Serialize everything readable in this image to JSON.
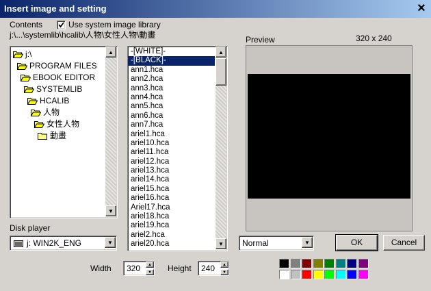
{
  "window": {
    "title": "Insert image and setting",
    "close_glyph": "✕"
  },
  "header": {
    "contents_label": "Contents",
    "use_library_label": "Use system image library",
    "use_library_checked": true,
    "path": "j:\\...\\systemlib\\hcalib\\人物\\女性人物\\動畫"
  },
  "tree": {
    "items": [
      {
        "label": "j:\\",
        "open": true
      },
      {
        "label": "PROGRAM FILES",
        "open": true
      },
      {
        "label": "EBOOK EDITOR",
        "open": true
      },
      {
        "label": "SYSTEMLIB",
        "open": true
      },
      {
        "label": "HCALIB",
        "open": true
      },
      {
        "label": "人物",
        "open": true
      },
      {
        "label": "女性人物",
        "open": true
      },
      {
        "label": "動畫",
        "open": false
      }
    ]
  },
  "file_list": {
    "items": [
      "-[WHITE]-",
      "-[BLACK]-",
      "ann1.hca",
      "ann2.hca",
      "ann3.hca",
      "ann4.hca",
      "ann5.hca",
      "ann6.hca",
      "ann7.hca",
      "ariel1.hca",
      "ariel10.hca",
      "ariel11.hca",
      "ariel12.hca",
      "ariel13.hca",
      "ariel14.hca",
      "ariel15.hca",
      "ariel16.hca",
      "Ariel17.hca",
      "ariel18.hca",
      "ariel19.hca",
      "ariel2.hca",
      "ariel20.hca"
    ],
    "selected_index": 1
  },
  "disk": {
    "label": "Disk player",
    "value": "j: WIN2K_ENG"
  },
  "preview": {
    "label": "Preview",
    "size_text": "320 x 240"
  },
  "mode": {
    "value": "Normal"
  },
  "buttons": {
    "ok": "OK",
    "cancel": "Cancel"
  },
  "size": {
    "width_label": "Width",
    "width_value": "320",
    "height_label": "Height",
    "height_value": "240"
  },
  "palette": {
    "row1": [
      "#000000",
      "#808080",
      "#800000",
      "#808000",
      "#008000",
      "#008080",
      "#000080",
      "#800080"
    ],
    "row2": [
      "#ffffff",
      "#c0c0c0",
      "#ff0000",
      "#ffff00",
      "#00ff00",
      "#00ffff",
      "#0000ff",
      "#ff00ff"
    ]
  }
}
